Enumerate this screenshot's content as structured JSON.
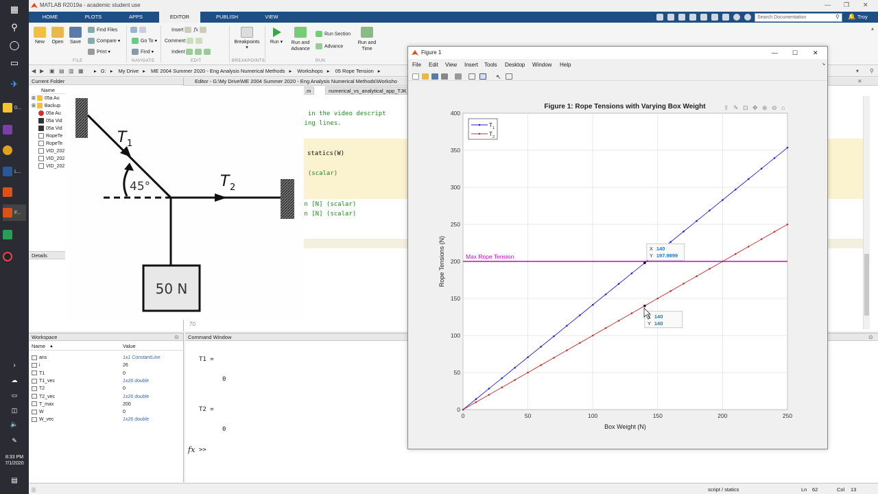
{
  "app": {
    "title": "MATLAB R2019a - academic student use",
    "tabs": [
      "HOME",
      "PLOTS",
      "APPS",
      "EDITOR",
      "PUBLISH",
      "VIEW"
    ],
    "active_tab": "EDITOR",
    "search_placeholder": "Search Documentation",
    "user": "Troy"
  },
  "toolstrip": {
    "file": {
      "new": "New",
      "open": "Open",
      "save": "Save",
      "find_files": "Find Files",
      "compare": "Compare",
      "print": "Print",
      "label": "FILE"
    },
    "navigate": {
      "goto": "Go To",
      "find": "Find",
      "label": "NAVIGATE"
    },
    "edit": {
      "insert": "Insert",
      "comment": "Comment",
      "indent": "Indent",
      "label": "EDIT"
    },
    "breakpoints": {
      "breakpoints": "Breakpoints",
      "label": "BREAKPOINTS"
    },
    "run": {
      "run": "Run",
      "run_advance": "Run and Advance",
      "run_section": "Run Section",
      "advance": "Advance",
      "run_time": "Run and Time",
      "label": "RUN"
    }
  },
  "breadcrumb": [
    "G:",
    "My Drive",
    "ME 2004 Summer 2020 - Eng Analysis Numerical Methods",
    "Workshops",
    "05 Rope Tension"
  ],
  "current_folder": {
    "title": "Current Folder",
    "col_name": "Name",
    "items": [
      "05a Au",
      "Backup",
      "05a Au",
      "05a Vid",
      "05a Vid",
      "RopeTe",
      "RopeTe",
      "VID_202",
      "VID_202",
      "VID_202"
    ],
    "details": "Details"
  },
  "editor": {
    "header": "Editor - G:\\My Drive\\ME 2004 Summer 2020 - Eng Analysis Numerical Methods\\Worksho",
    "tabs": [
      ".m",
      "numerical_vs_analytical_app_TJK"
    ],
    "code_lines": [
      "k in the video descript",
      "king lines.",
      "statics(W)",
      "] (scalar)",
      "on [N] (scalar)",
      "on [N] (scalar)"
    ],
    "line_number": "70"
  },
  "diagram": {
    "t1": "T",
    "t1_sub": "1",
    "t2": "T",
    "t2_sub": "2",
    "angle": "45°",
    "box": "50 N"
  },
  "workspace": {
    "title": "Workspace",
    "col_name": "Name",
    "col_value": "Value",
    "vars": [
      {
        "name": "ans",
        "value": "1x1 ConstantLine",
        "italic": true
      },
      {
        "name": "i",
        "value": "26",
        "italic": false
      },
      {
        "name": "T1",
        "value": "0",
        "italic": false
      },
      {
        "name": "T1_vec",
        "value": "1x26 double",
        "italic": true
      },
      {
        "name": "T2",
        "value": "0",
        "italic": false
      },
      {
        "name": "T2_vec",
        "value": "1x26 double",
        "italic": true
      },
      {
        "name": "T_max",
        "value": "200",
        "italic": false
      },
      {
        "name": "W",
        "value": "0",
        "italic": false
      },
      {
        "name": "W_vec",
        "value": "1x26 double",
        "italic": true
      }
    ]
  },
  "command_window": {
    "title": "Command Window",
    "lines": [
      "T1 =",
      "0",
      "T2 =",
      "0"
    ],
    "prompt": ">>"
  },
  "status": {
    "script": "script / statics",
    "ln": "Ln",
    "ln_val": "62",
    "col": "Col",
    "col_val": "13"
  },
  "clock": {
    "time": "8:33 PM",
    "date": "7/1/2020"
  },
  "figure": {
    "window_title": "Figure 1",
    "menu": [
      "File",
      "Edit",
      "View",
      "Insert",
      "Tools",
      "Desktop",
      "Window",
      "Help"
    ],
    "datatips": [
      {
        "x_label": "X",
        "x": "140",
        "y_label": "Y",
        "y": "197.9899"
      },
      {
        "x_label": "X",
        "x": "140",
        "y_label": "Y",
        "y": "140"
      }
    ],
    "max_label": "Max Rope Tension"
  },
  "chart_data": {
    "type": "line",
    "title": "Figure 1: Rope Tensions with Varying Box Weight",
    "xlabel": "Box Weight (N)",
    "ylabel": "Rope Tensions (N)",
    "xlim": [
      0,
      250
    ],
    "ylim": [
      0,
      400
    ],
    "xticks": [
      0,
      50,
      100,
      150,
      200,
      250
    ],
    "yticks": [
      0,
      50,
      100,
      150,
      200,
      250,
      300,
      350,
      400
    ],
    "grid": true,
    "legend_position": "top-left",
    "x": [
      0,
      10,
      20,
      30,
      40,
      50,
      60,
      70,
      80,
      90,
      100,
      110,
      120,
      130,
      140,
      150,
      160,
      170,
      180,
      190,
      200,
      210,
      220,
      230,
      240,
      250
    ],
    "series": [
      {
        "name": "T1",
        "color": "#2222cc",
        "values": [
          0,
          14.14,
          28.28,
          42.43,
          56.57,
          70.71,
          84.85,
          98.99,
          113.14,
          127.28,
          141.42,
          155.56,
          169.71,
          183.85,
          197.99,
          212.13,
          226.27,
          240.42,
          254.56,
          268.7,
          282.84,
          296.98,
          311.13,
          325.27,
          339.41,
          353.55
        ]
      },
      {
        "name": "T2",
        "color": "#c03030",
        "values": [
          0,
          10,
          20,
          30,
          40,
          50,
          60,
          70,
          80,
          90,
          100,
          110,
          120,
          130,
          140,
          150,
          160,
          170,
          180,
          190,
          200,
          210,
          220,
          230,
          240,
          250
        ]
      }
    ],
    "hline": {
      "value": 200,
      "label": "Max Rope Tension",
      "color": "#cc00cc"
    },
    "legend": [
      {
        "label": "T",
        "sub": "1"
      },
      {
        "label": "T",
        "sub": "2"
      }
    ]
  }
}
